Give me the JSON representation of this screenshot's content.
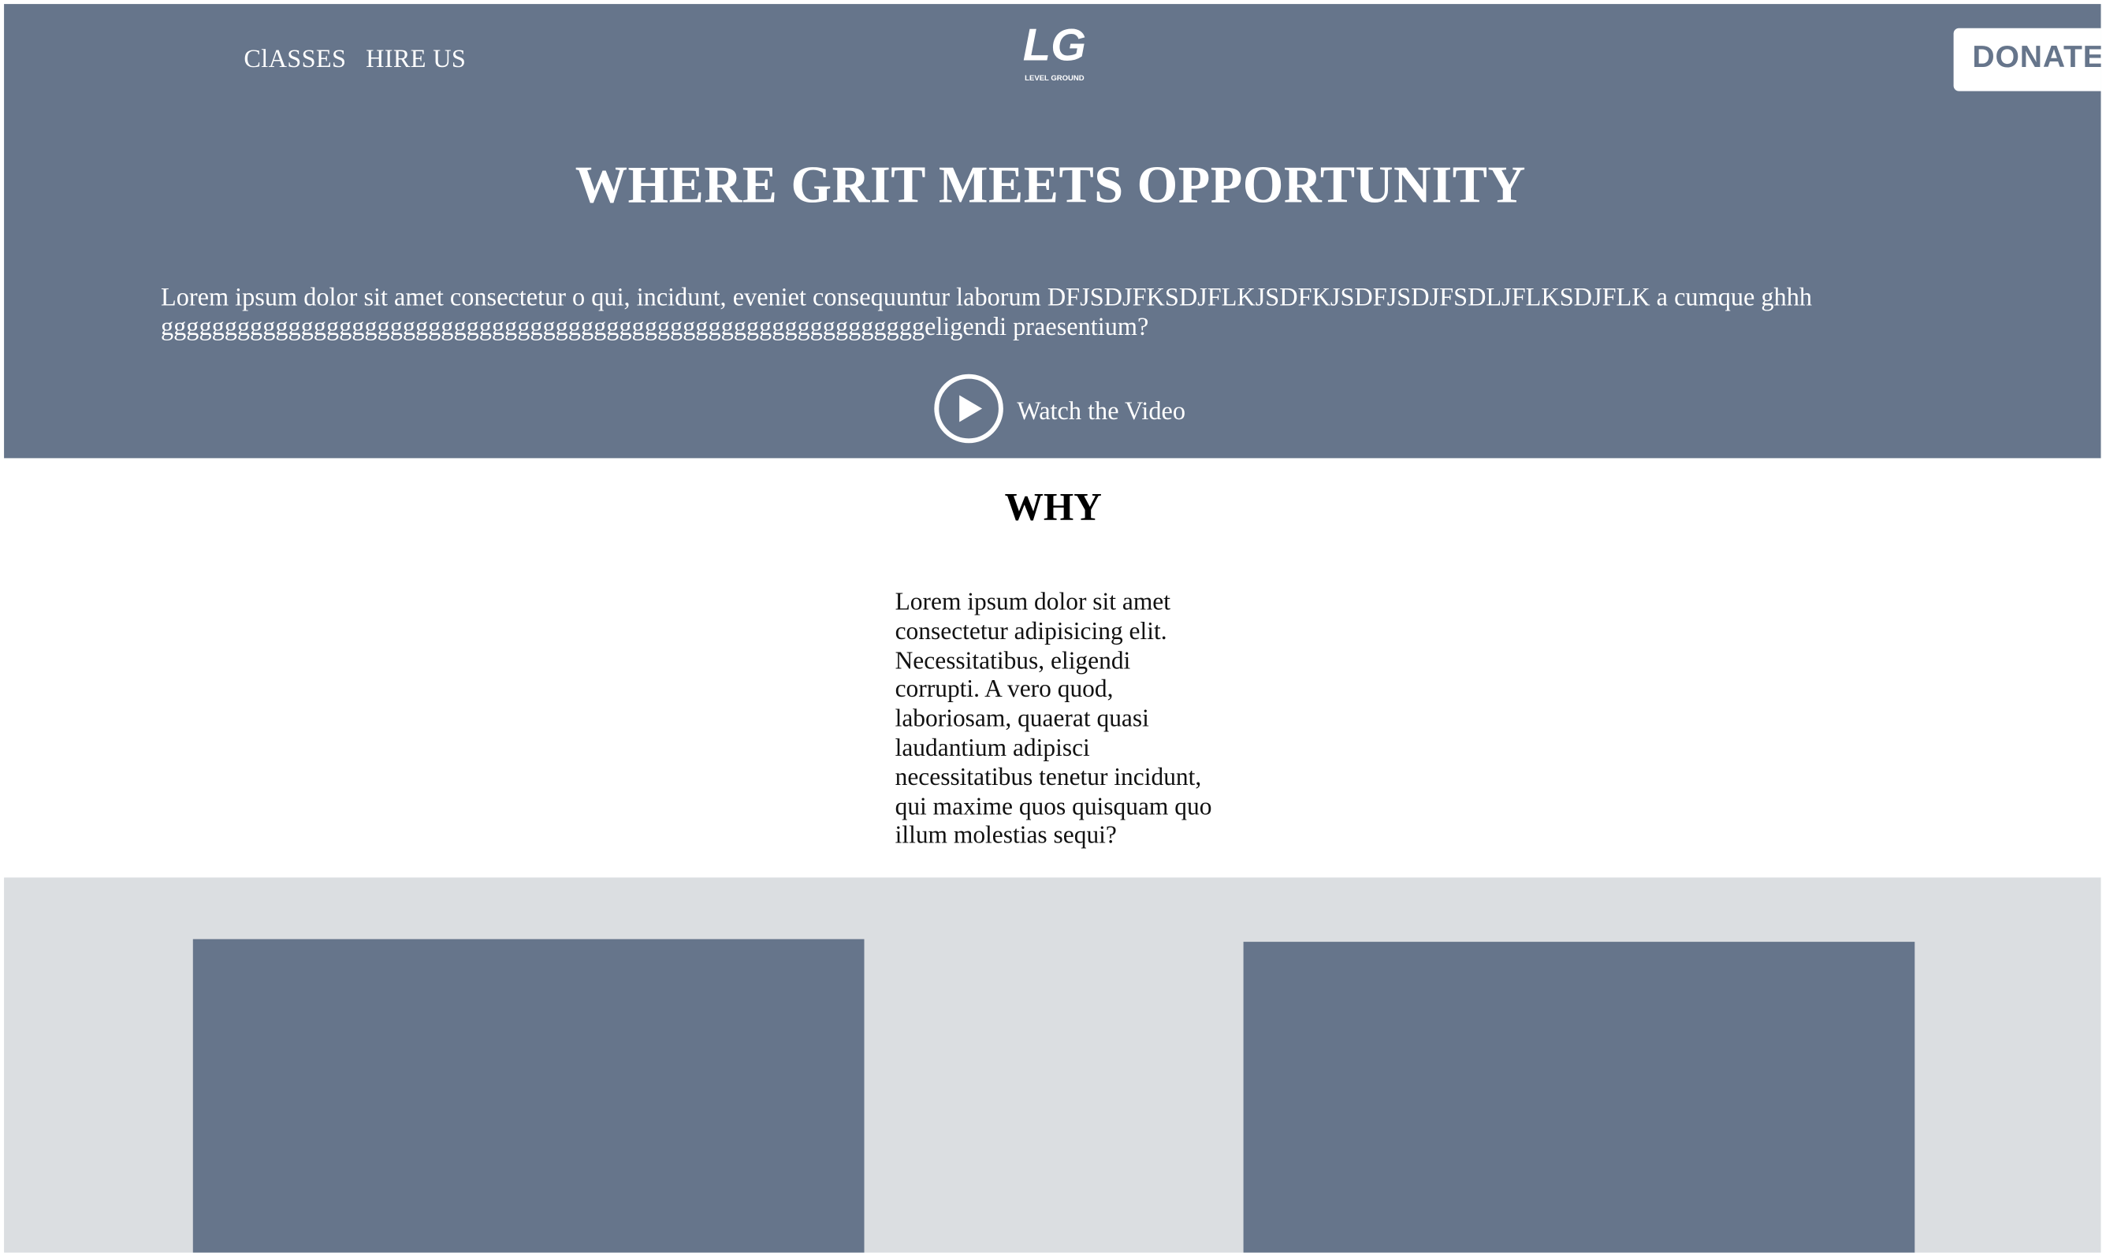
{
  "nav": {
    "links": [
      {
        "label": "ClASSES"
      },
      {
        "label": "HIRE US"
      }
    ],
    "donate_label": "DONATE"
  },
  "logo": {
    "icon": "level-ground-logo",
    "mark_text": "LG",
    "caption": "LEVEL GROUND"
  },
  "hero": {
    "title": "WHERE GRIT MEETS OPPORTUNITY",
    "text": "Lorem ipsum dolor sit amet consectetur o qui, incidunt, eveniet consequuntur laborum DFJSDJFKSDJFLKJSDFKJSDFJSDJFSDLJFLKSDJFLK a cumque ghhhggggggggggggggggggggggggggggggggggggggggggggggggggggggggggggeligendi praesentium?",
    "video_icon": "play-circle-icon",
    "video_label": "Watch the Video"
  },
  "why": {
    "title": "WHY",
    "text": "Lorem ipsum dolor sit amet consectetur adipisicing elit. Necessitatibus, eligendi corrupti. A vero quod, laboriosam, quaerat quasi laudantium adipisci necessitatibus tenetur incidunt, qui maxime quos quisquam quo illum molestias sequi?"
  },
  "colors": {
    "hero_bg": "#66758b",
    "section_bg": "#dbdee1",
    "card_bg": "#66758b",
    "text_light": "#ffffff",
    "text_dark": "#000000"
  }
}
